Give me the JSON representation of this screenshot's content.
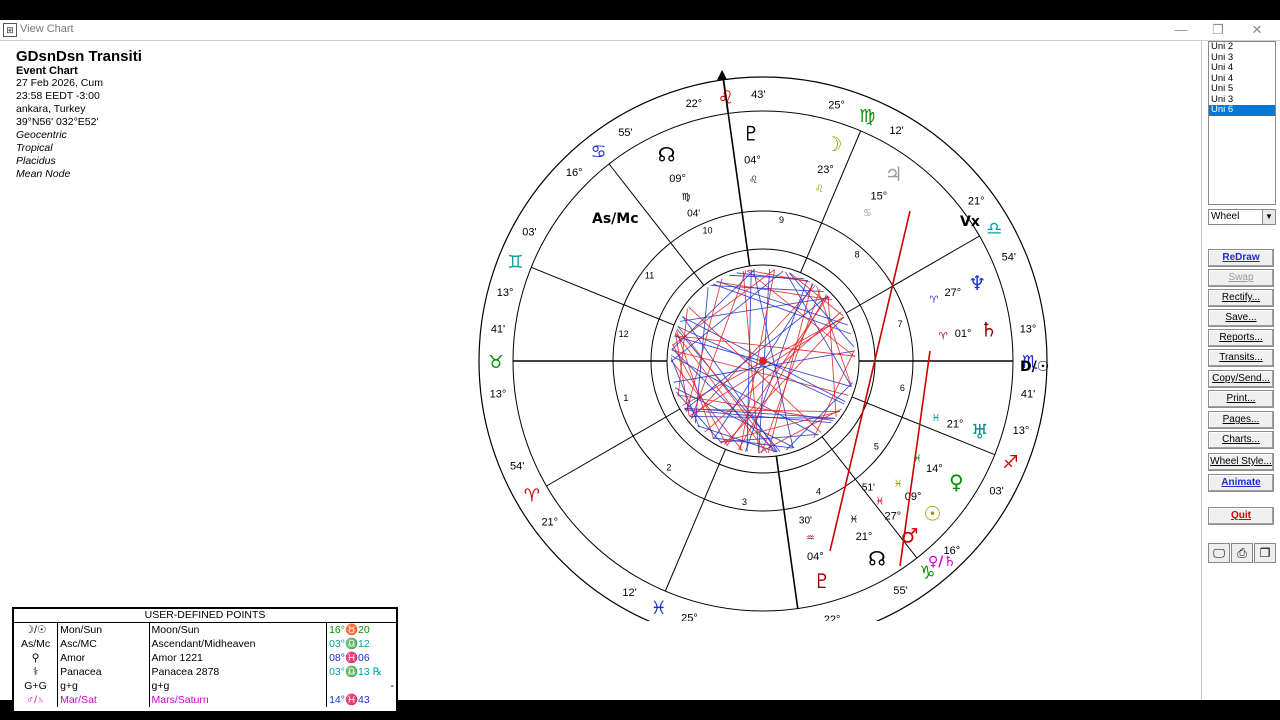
{
  "window": {
    "title": "View Chart",
    "app_icon": "chart-app-icon",
    "minimize_glyph": "—",
    "restore_glyph": "❐",
    "close_glyph": "✕"
  },
  "info": {
    "title": "GDsnDsn Transiti",
    "chart_type": "Event Chart",
    "date": "27 Feb 2026, Cum",
    "time": "23:58  EEDT -3:00",
    "place": "ankara, Turkey",
    "coords": "39°N56' 032°E52'",
    "options": [
      "Geocentric",
      "Tropical",
      "Placidus",
      "Mean Node"
    ]
  },
  "wheel": {
    "sign_glyphs": [
      {
        "glyph": "♌",
        "deg": "22°",
        "min": "43'",
        "color": "#cc0000"
      },
      {
        "glyph": "♋",
        "deg": "16°",
        "min": "55'",
        "color": "#1a2fd0"
      },
      {
        "glyph": "♊",
        "deg": "13°",
        "min": "03'",
        "color": "#00a0a0"
      },
      {
        "glyph": "♉",
        "deg": "13°",
        "min": "41'",
        "color": "#009000"
      },
      {
        "glyph": "♈",
        "deg": "21°",
        "min": "54'",
        "color": "#cc0000"
      },
      {
        "glyph": "♓",
        "deg": "25°",
        "min": "12'",
        "color": "#1a2fd0"
      },
      {
        "glyph": "♒",
        "deg": "22°",
        "min": "43'",
        "color": "#00a0a0"
      },
      {
        "glyph": "♑",
        "deg": "16°",
        "min": "55'",
        "color": "#009000"
      },
      {
        "glyph": "♐",
        "deg": "13°",
        "min": "03'",
        "color": "#cc0000"
      },
      {
        "glyph": "♏",
        "deg": "13°",
        "min": "41'",
        "color": "#1a2fd0"
      },
      {
        "glyph": "♎",
        "deg": "21°",
        "min": "54'",
        "color": "#00a0a0"
      },
      {
        "glyph": "♍",
        "deg": "25°",
        "min": "12'",
        "color": "#009000"
      }
    ],
    "house_numbers": [
      "1",
      "2",
      "3",
      "4",
      "5",
      "6",
      "7",
      "8",
      "9",
      "10",
      "11",
      "12"
    ],
    "planets": [
      {
        "glyph": "♇",
        "deg": "04°",
        "sign": "♒",
        "min": "30'",
        "color": "#990000"
      },
      {
        "glyph": "☊",
        "deg": "21°",
        "sign": "♓",
        "min": "",
        "color": "#000000"
      },
      {
        "glyph": "♂",
        "deg": "27°",
        "sign": "♓",
        "min": "51'",
        "color": "#cc0000"
      },
      {
        "glyph": "☉",
        "deg": "09°",
        "sign": "♓",
        "min": "",
        "color": "#999900"
      },
      {
        "glyph": "♀",
        "deg": "14°",
        "sign": "♓",
        "min": "",
        "color": "#009000"
      },
      {
        "glyph": "♅",
        "deg": "21°",
        "sign": "♓",
        "min": "",
        "color": "#009090"
      },
      {
        "glyph": "♄",
        "deg": "01°",
        "sign": "♈",
        "min": "",
        "color": "#990000"
      },
      {
        "glyph": "♆",
        "deg": "27°",
        "sign": "♈",
        "min": "",
        "color": "#1a2fd0"
      },
      {
        "glyph": "♃",
        "deg": "15°",
        "sign": "♋",
        "min": "",
        "color": "#999999"
      },
      {
        "glyph": "☽",
        "deg": "23°",
        "sign": "♌",
        "min": "",
        "color": "#999900"
      },
      {
        "glyph": "♇",
        "deg": "04°",
        "sign": "♌",
        "min": "",
        "color": "#000000"
      },
      {
        "glyph": "☊",
        "deg": "09°",
        "sign": "♍",
        "min": "04'",
        "color": "#000000"
      }
    ],
    "annotations": [
      "Vx",
      "As/Mc",
      "D/☉",
      "♀/♄"
    ]
  },
  "udp": {
    "header": "USER-DEFINED POINTS",
    "rows": [
      {
        "sym": "☽/☉",
        "name": "Mon/Sun",
        "full": "Moon/Sun",
        "pos": "16°♉20",
        "color": "#000000",
        "pos_color": "#009000"
      },
      {
        "sym": "As/Mc",
        "name": "Asc/MC",
        "full": "Ascendant/Midheaven",
        "pos": "03°♎12",
        "color": "#000000",
        "pos_color": "#00a0a0"
      },
      {
        "sym": "⚲",
        "name": "Amor",
        "full": "Amor 1221",
        "pos": "08°♓06",
        "color": "#000000",
        "pos_color": "#1a2fd0"
      },
      {
        "sym": "⚕",
        "name": "Panacea",
        "full": "Panacea 2878",
        "pos": "03°♎13 ℞",
        "color": "#000000",
        "pos_color": "#00a0a0"
      },
      {
        "sym": "G+G",
        "name": "g+g",
        "full": "g+g",
        "pos": "-",
        "color": "#000000",
        "pos_color": "#000000"
      },
      {
        "sym": "♂/♄",
        "name": "Mar/Sat",
        "full": "Mars/Saturn",
        "pos": "14°♓43",
        "color": "#d000d0",
        "pos_color": "#1a2fd0"
      }
    ]
  },
  "sidebar": {
    "uni_list": [
      "Uni 2",
      "Uni 3",
      "Uni 4",
      "Uni 4",
      "Uni 5",
      "Uni 3",
      "Uni 6"
    ],
    "selected_index": 6,
    "mode": "Wheel",
    "buttons": [
      {
        "label": "ReDraw",
        "style": "blue"
      },
      {
        "label": "Swap",
        "style": "dis"
      },
      {
        "label": "Rectify...",
        "style": ""
      },
      {
        "label": "Save...",
        "style": ""
      },
      {
        "label": "Reports...",
        "style": ""
      },
      {
        "label": "Transits...",
        "style": ""
      },
      {
        "label": "Copy/Send...",
        "style": ""
      },
      {
        "label": "Print...",
        "style": ""
      },
      {
        "label": "Pages...",
        "style": ""
      },
      {
        "label": "Charts...",
        "style": ""
      },
      {
        "label": "Wheel Style...",
        "style": ""
      },
      {
        "label": "Animate",
        "style": "blue"
      }
    ],
    "quit_label": "Quit",
    "icon_buttons": [
      "monitor-icon",
      "printer-icon",
      "copy-icon"
    ]
  }
}
